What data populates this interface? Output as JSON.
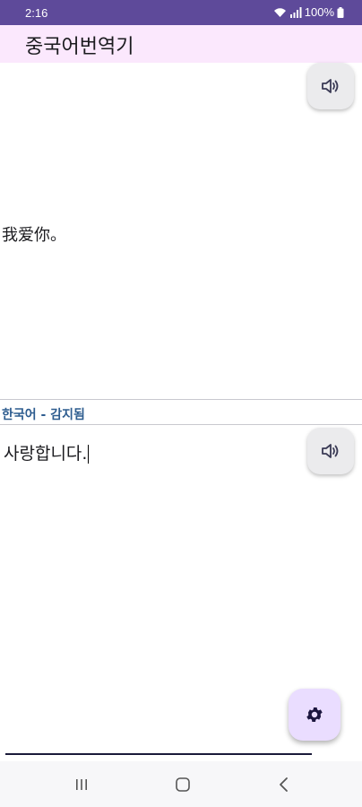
{
  "status": {
    "time": "2:16",
    "battery": "100%",
    "wifi_icon": "wifi-icon",
    "signal_icon": "signal-icon",
    "battery_icon": "battery-icon"
  },
  "app": {
    "title": "중국어번역기"
  },
  "source": {
    "text": "我爱你。",
    "speak_icon": "speaker-icon"
  },
  "target": {
    "language_label": "한국어 - 감지됨",
    "text": "사랑합니다.",
    "speak_icon": "speaker-icon"
  },
  "fab": {
    "icon": "gear-icon",
    "background": "#eaddff"
  },
  "nav": {
    "recent_icon": "recent-apps-icon",
    "home_icon": "home-icon",
    "back_icon": "back-icon"
  },
  "colors": {
    "status_bar": "#5e4a9a",
    "app_bar": "#fbe8fd",
    "language_label": "#2d5c8f"
  }
}
